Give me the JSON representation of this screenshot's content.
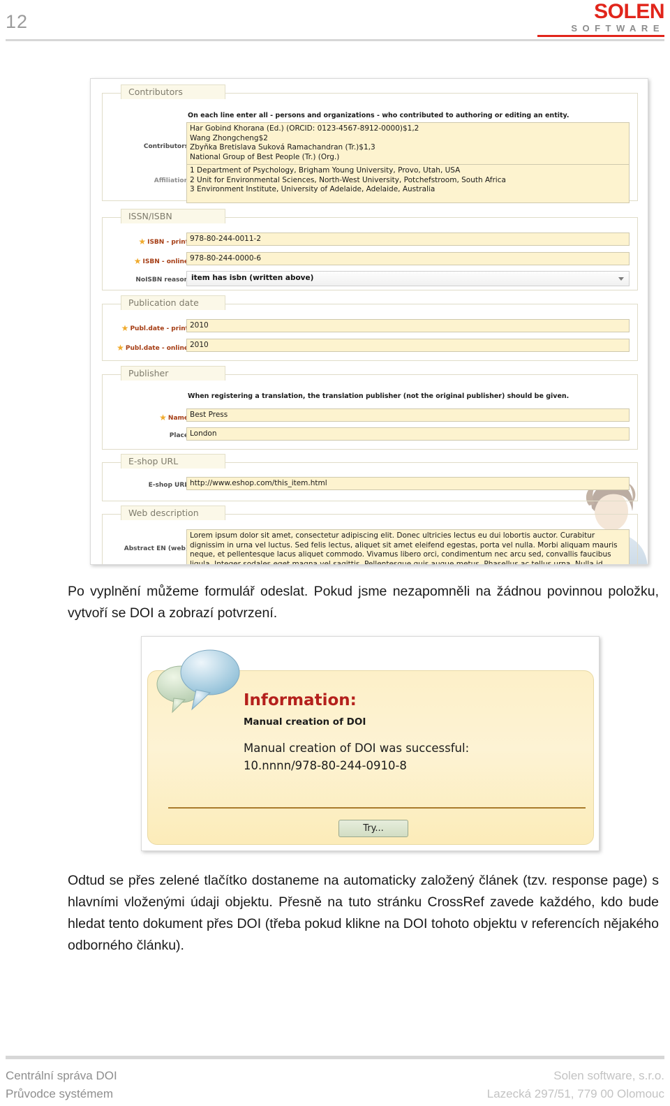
{
  "header": {
    "page_number": "12",
    "logo_primary": "SOLEN",
    "logo_secondary": "SOFTWARE",
    "logo_color": "#e1251b",
    "logo_secondary_color": "#8c8c8c"
  },
  "form_screenshot": {
    "sections": {
      "contributors": {
        "legend": "Contributors",
        "hint": "On each line enter all - persons and organizations - who contributed to authoring or editing an entity.",
        "rows": {
          "contributors": {
            "label": "Contributors",
            "value": "Har Gobind Khorana (Ed.) (ORCID: 0123-4567-8912-0000)$1,2\nWang Zhongcheng$2\nZbyňka Bretislava Suková Ramachandran (Tr.)$1,3\nNational Group of Best People (Tr.) (Org.)"
          },
          "affiliation": {
            "label": "Affiliation",
            "value": "1 Department of Psychology, Brigham Young University, Provo, Utah, USA\n2 Unit for Environmental Sciences, North-West University, Potchefstroom, South Africa\n3 Environment Institute, University of Adelaide, Adelaide, Australia"
          }
        }
      },
      "issn_isbn": {
        "legend": "ISSN/ISBN",
        "rows": {
          "isbn_print": {
            "label": "ISBN - print",
            "value": "978-80-244-0011-2",
            "required": true
          },
          "isbn_online": {
            "label": "ISBN - online",
            "value": "978-80-244-0000-6",
            "required": true
          },
          "noisbn_reason": {
            "label": "NoISBN reason",
            "value": "item has isbn (written above)",
            "required": false
          }
        }
      },
      "publication_date": {
        "legend": "Publication date",
        "rows": {
          "publdate_print": {
            "label": "Publ.date - print",
            "value": "2010",
            "required": true
          },
          "publdate_online": {
            "label": "Publ.date - online",
            "value": "2010",
            "required": true
          }
        }
      },
      "publisher": {
        "legend": "Publisher",
        "hint": "When registering a translation, the translation publisher (not the original publisher) should be given.",
        "rows": {
          "name": {
            "label": "Name",
            "value": "Best Press",
            "required": true
          },
          "place": {
            "label": "Place",
            "value": "London",
            "required": false
          }
        }
      },
      "eshop_url": {
        "legend": "E-shop URL",
        "rows": {
          "eshop_url": {
            "label": "E-shop URL",
            "value": "http://www.eshop.com/this_item.html",
            "required": false
          }
        }
      },
      "web_description": {
        "legend": "Web description",
        "rows": {
          "abstract_en": {
            "label": "Abstract EN (web)",
            "value": "Lorem ipsum dolor sit amet, consectetur adipiscing elit. Donec ultricies lectus eu dui lobortis auctor. Curabitur dignissim in urna vel luctus. Sed felis lectus, aliquet sit amet eleifend egestas, porta vel nulla. Morbi aliquam mauris neque, et pellentesque lacus aliquet commodo. Vivamus libero orci, condimentum nec arcu sed, convallis faucibus ligula. Integer sodales eget magna vel sagittis. Pellentesque quis augue metus. Phasellus ac tellus urna. Nulla id egestas arcu."
          }
        }
      }
    },
    "field_bg_color": "#fdf3cf",
    "required_star_color": "#f0ab2e"
  },
  "body": {
    "paragraph_1": "Po vyplnění můžeme formulář odeslat. Pokud jsme nezapomněli na žádnou povinnou položku, vytvoří se DOI a zobrazí potvrzení.",
    "paragraph_2": "Odtud se přes zelené tlačítko dostaneme na automaticky založený článek (tzv. response page) s hlavními vloženými údaji objektu. Přesně na tuto stránku CrossRef zavede každého, kdo bude hledat tento dokument přes DOI (třeba pokud klikne na DOI tohoto objektu v referencích nějakého odborného článku)."
  },
  "dialog_screenshot": {
    "title": "Information:",
    "subtitle": "Manual creation of DOI",
    "message": "Manual creation of DOI was successful:\n10.nnnn/978-80-244-0910-8",
    "button_label": "Try...",
    "title_color": "#b4201c",
    "panel_color": "#fdf0c8",
    "button_color": "#d2ddc3"
  },
  "footer": {
    "left_line_1": "Centrální správa DOI",
    "left_line_2": "Průvodce systémem",
    "right_line_1": "Solen software, s.r.o.",
    "right_line_2": "Lazecká 297/51, 779 00 Olomouc"
  }
}
